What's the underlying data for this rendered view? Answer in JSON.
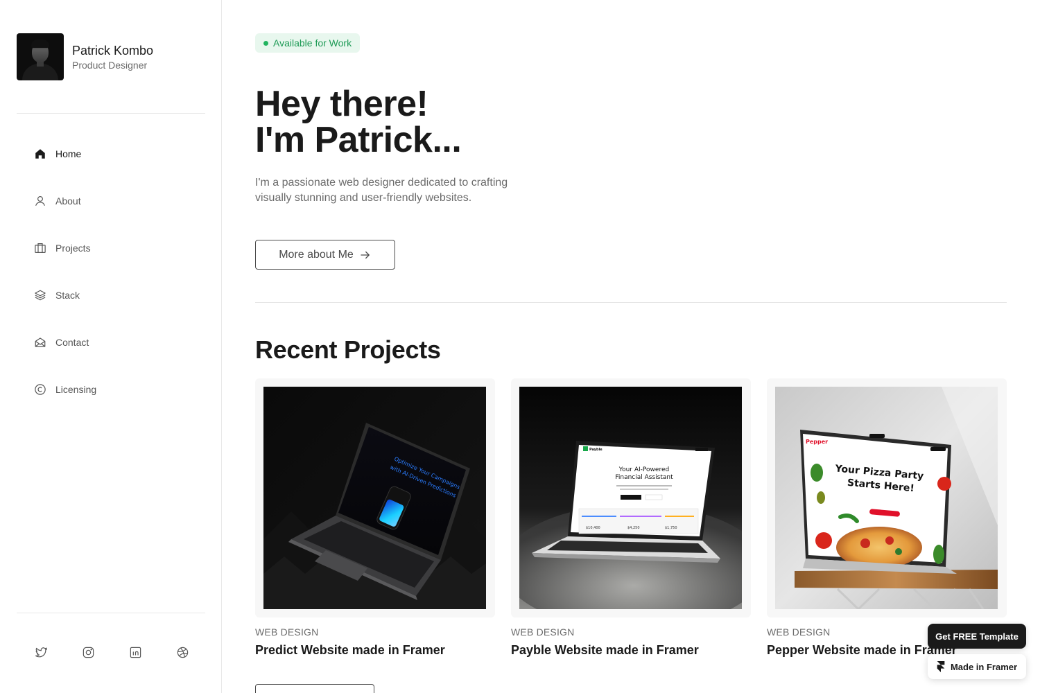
{
  "profile": {
    "name": "Patrick Kombo",
    "role": "Product Designer"
  },
  "nav": {
    "items": [
      {
        "label": "Home",
        "icon": "home-icon",
        "active": true
      },
      {
        "label": "About",
        "icon": "user-icon"
      },
      {
        "label": "Projects",
        "icon": "briefcase-icon"
      },
      {
        "label": "Stack",
        "icon": "layers-icon"
      },
      {
        "label": "Contact",
        "icon": "mail-open-icon"
      },
      {
        "label": "Licensing",
        "icon": "copyright-icon"
      }
    ]
  },
  "socials": [
    "twitter-icon",
    "instagram-icon",
    "linkedin-icon",
    "dribbble-icon"
  ],
  "hero": {
    "badge": "Available for Work",
    "title_line1": "Hey there!",
    "title_line2": "I'm Patrick...",
    "subtitle": "I'm  a passionate web designer dedicated to crafting visually stunning and user-friendly websites.",
    "cta": "More about Me"
  },
  "projects_section": {
    "title": "Recent Projects",
    "items": [
      {
        "category": "WEB DESIGN",
        "title": "Predict Website made in Framer",
        "mockup_heading": "Optimize Your Campaigns with AI-Driven Predictions"
      },
      {
        "category": "WEB DESIGN",
        "title": "Payble Website made in Framer",
        "mockup_heading": "Your AI-Powered Financial Assistant",
        "mockup_brand": "Payble",
        "mockup_amounts": [
          "$10,400",
          "$4,250",
          "$1,750"
        ]
      },
      {
        "category": "WEB DESIGN",
        "title": "Pepper Website made in Framer",
        "mockup_heading": "Your Pizza Party Starts Here!",
        "mockup_brand": "Pepper"
      }
    ]
  },
  "framer": {
    "get_template": "Get FREE Template",
    "made_in": "Made in Framer"
  },
  "colors": {
    "accent_green": "#22b45f",
    "badge_bg": "#e8f7ee",
    "text_dark": "#1a1a1a",
    "text_muted": "#6b6b6b"
  }
}
